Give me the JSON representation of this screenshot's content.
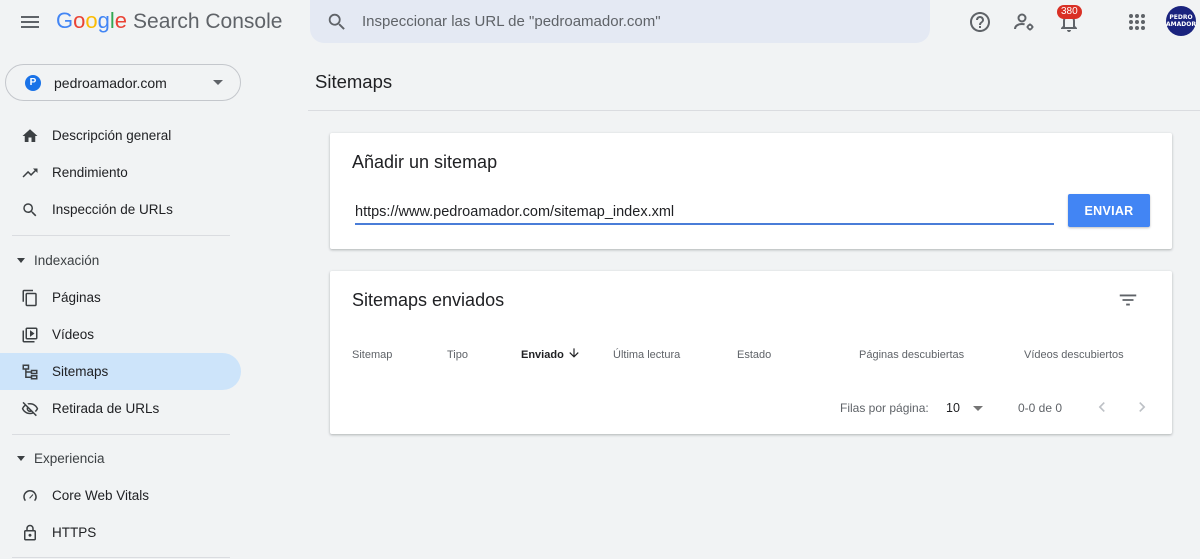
{
  "header": {
    "logo_google": [
      "G",
      "o",
      "o",
      "g",
      "l",
      "e"
    ],
    "logo_colors": [
      "#4285f4",
      "#ea4335",
      "#fbbc05",
      "#4285f4",
      "#34a853",
      "#ea4335"
    ],
    "logo_product": "Search Console",
    "search_placeholder": "Inspeccionar las URL de \"pedroamador.com\"",
    "notifications_count": "380",
    "avatar_text": "PEDRO AMADOR"
  },
  "sidebar": {
    "property": {
      "icon_letter": "P",
      "label": "pedroamador.com"
    },
    "items_top": [
      {
        "label": "Descripción general",
        "icon": "home-icon"
      },
      {
        "label": "Rendimiento",
        "icon": "trending-up-icon"
      },
      {
        "label": "Inspección de URLs",
        "icon": "search-icon"
      }
    ],
    "section_indexing": "Indexación",
    "items_indexing": [
      {
        "label": "Páginas",
        "icon": "pages-icon"
      },
      {
        "label": "Vídeos",
        "icon": "video-icon"
      },
      {
        "label": "Sitemaps",
        "icon": "sitemap-icon",
        "active": true
      },
      {
        "label": "Retirada de URLs",
        "icon": "eye-off-icon"
      }
    ],
    "section_experience": "Experiencia",
    "items_experience": [
      {
        "label": "Core Web Vitals",
        "icon": "gauge-icon"
      },
      {
        "label": "HTTPS",
        "icon": "lock-icon"
      }
    ]
  },
  "main": {
    "title": "Sitemaps",
    "add_card": {
      "title": "Añadir un sitemap",
      "input_value": "https://www.pedroamador.com/sitemap_index.xml",
      "submit_label": "ENVIAR"
    },
    "submitted_card": {
      "title": "Sitemaps enviados",
      "columns": [
        "Sitemap",
        "Tipo",
        "Enviado",
        "Última lectura",
        "Estado",
        "Páginas descubiertas",
        "Vídeos descubiertos"
      ],
      "rows_per_page_label": "Filas por página:",
      "rows_per_page_value": "10",
      "range_label": "0-0 de 0"
    }
  },
  "colors": {
    "accent": "#4285f4",
    "active_nav": "#cde4fa",
    "background": "#f1f3f4"
  }
}
